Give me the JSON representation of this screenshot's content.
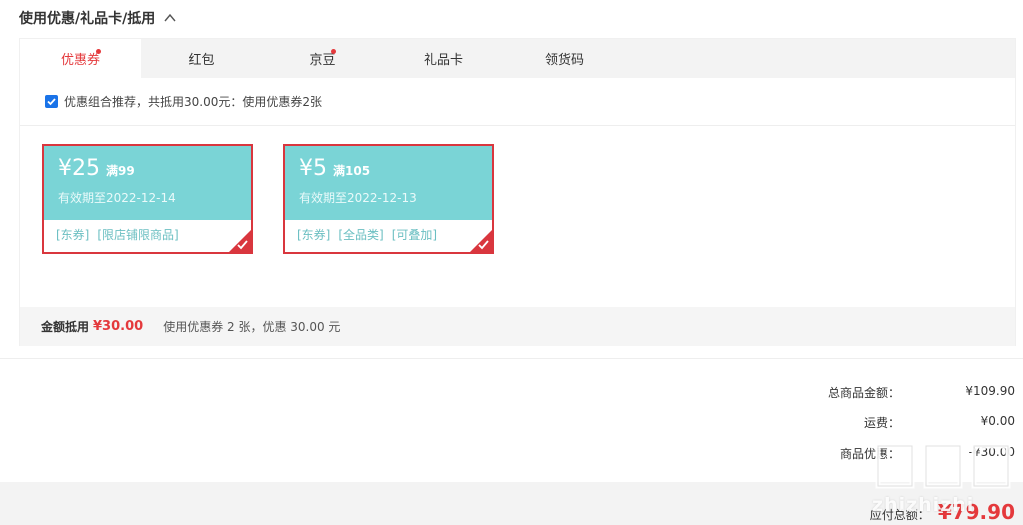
{
  "section": {
    "title": "使用优惠/礼品卡/抵用"
  },
  "tabs": [
    {
      "label": "优惠券",
      "active": true,
      "dot": true
    },
    {
      "label": "红包",
      "active": false,
      "dot": false
    },
    {
      "label": "京豆",
      "active": false,
      "dot": true
    },
    {
      "label": "礼品卡",
      "active": false,
      "dot": false
    },
    {
      "label": "领货码",
      "active": false,
      "dot": false
    }
  ],
  "combo": {
    "checked": true,
    "text": "优惠组合推荐，共抵用30.00元：使用优惠券2张"
  },
  "coupons": [
    {
      "amount": "¥25",
      "condition": "满99",
      "expiry": "有效期至2022-12-14",
      "tags": [
        "[东券]",
        "[限店铺限商品]"
      ],
      "selected": true
    },
    {
      "amount": "¥5",
      "condition": "满105",
      "expiry": "有效期至2022-12-13",
      "tags": [
        "[东券]",
        "[全品类]",
        "[可叠加]"
      ],
      "selected": true
    }
  ],
  "summary": {
    "label": "金额抵用",
    "amount": "¥30.00",
    "desc": "使用优惠券 2 张，优惠 30.00 元"
  },
  "fees": [
    {
      "label": "总商品金额：",
      "value": "¥109.90"
    },
    {
      "label": "运费：",
      "value": "¥0.00"
    },
    {
      "label": "商品优惠：",
      "value": "-¥30.00"
    }
  ],
  "total": {
    "label": "应付总额：",
    "value": "¥79.90"
  },
  "watermark": {
    "text": "zhizhizhi"
  },
  "colors": {
    "accent": "#e4393c",
    "coupon_bg": "#7ad4d6",
    "coupon_border": "#d9363e"
  }
}
